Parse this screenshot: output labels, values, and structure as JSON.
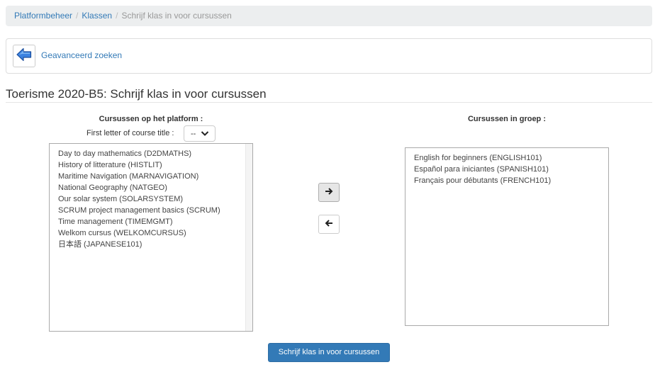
{
  "breadcrumb": {
    "items": [
      "Platformbeheer",
      "Klassen"
    ],
    "separator": "/",
    "current": "Schrijf klas in voor cursussen"
  },
  "toolbar": {
    "back_icon": "arrow-left-icon",
    "advanced_search": "Geavanceerd zoeken"
  },
  "page": {
    "title": "Toerisme 2020-B5: Schrijf klas in voor cursussen"
  },
  "left": {
    "heading": "Cursussen op het platform :",
    "filter_label": "First letter of course title :",
    "filter_value": "--",
    "items": [
      "Day to day mathematics (D2DMATHS)",
      "History of litterature (HISTLIT)",
      "Maritime Navigation (MARNAVIGATION)",
      "National Geography (NATGEO)",
      "Our solar system (SOLARSYSTEM)",
      "SCRUM project management basics (SCRUM)",
      "Time management (TIMEMGMT)",
      "Welkom cursus (WELKOMCURSUS)",
      "日本語 (JAPANESE101)"
    ]
  },
  "right": {
    "heading": "Cursussen in groep :",
    "items": [
      "English for beginners (ENGLISH101)",
      "Español para iniciantes (SPANISH101)",
      "Français pour débutants (FRENCH101)"
    ]
  },
  "buttons": {
    "add_icon": "arrow-right-icon",
    "remove_icon": "arrow-left-icon",
    "submit": "Schrijf klas in voor cursussen"
  },
  "colors": {
    "link": "#337ab7",
    "primary": "#337ab7",
    "breadcrumb_bg": "#eceeef",
    "back_icon": "#2a6fd6"
  }
}
